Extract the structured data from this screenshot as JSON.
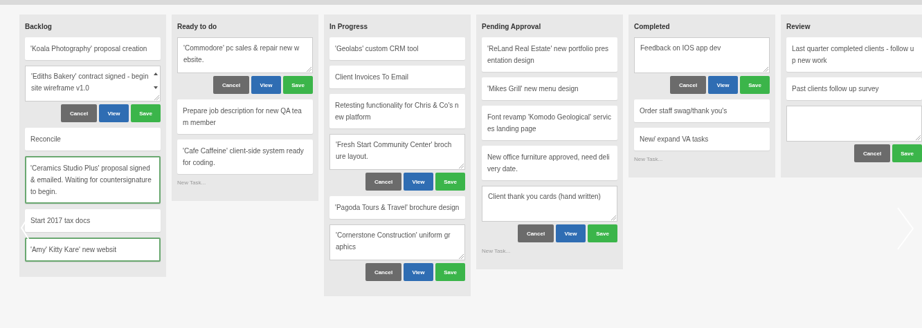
{
  "columns": [
    {
      "title": "Backlog",
      "cards": [
        {
          "kind": "card",
          "text": "'Koala Photography' proposal creation"
        },
        {
          "kind": "editing",
          "text": "'Ediths Bakery' contract signed - begin site wireframe v1.0",
          "scrollable": true,
          "buttons": [
            {
              "kind": "cancel",
              "label": "Cancel"
            },
            {
              "kind": "view",
              "label": "View"
            },
            {
              "kind": "save",
              "label": "Save"
            }
          ]
        },
        {
          "kind": "card",
          "text": "Reconcile"
        },
        {
          "kind": "highlighted",
          "text": "'Ceramics Studio Plus' proposal signed & emailed. Waiting for countersignature to begin."
        },
        {
          "kind": "card",
          "text": "Start 2017 tax docs"
        },
        {
          "kind": "highlighted",
          "text": "'Amy' Kitty Kare' new websit"
        }
      ]
    },
    {
      "title": "Ready to do",
      "cards": [
        {
          "kind": "editing",
          "text": "'Commodore' pc sales & repair new website.",
          "buttons": [
            {
              "kind": "cancel",
              "label": "Cancel"
            },
            {
              "kind": "view",
              "label": "View"
            },
            {
              "kind": "save",
              "label": "Save"
            }
          ]
        },
        {
          "kind": "card",
          "text": "Prepare job description for new QA team member"
        },
        {
          "kind": "card",
          "text": "'Cafe Caffeine' client-side system ready for coding."
        }
      ],
      "new_task_placeholder": "New Task..."
    },
    {
      "title": "In Progress",
      "cards": [
        {
          "kind": "card",
          "text": "'Geolabs' custom CRM tool"
        },
        {
          "kind": "card",
          "text": "Client Invoices To Email"
        },
        {
          "kind": "card",
          "text": "Retesting functionality for Chris & Co's new platform"
        },
        {
          "kind": "editing",
          "text": "'Fresh Start Community Center' brochure layout.",
          "buttons": [
            {
              "kind": "cancel",
              "label": "Cancel"
            },
            {
              "kind": "view",
              "label": "View"
            },
            {
              "kind": "save",
              "label": "Save"
            }
          ]
        },
        {
          "kind": "card",
          "text": "'Pagoda Tours & Travel' brochure design"
        },
        {
          "kind": "editing",
          "text": "'Cornerstone Construction' uniform graphics",
          "buttons": [
            {
              "kind": "cancel",
              "label": "Cancel"
            },
            {
              "kind": "view",
              "label": "View"
            },
            {
              "kind": "save",
              "label": "Save"
            }
          ]
        }
      ]
    },
    {
      "title": "Pending Approval",
      "cards": [
        {
          "kind": "card",
          "text": "'ReLand Real Estate' new portfolio presentation design"
        },
        {
          "kind": "card",
          "text": "'Mikes Grill' new menu design"
        },
        {
          "kind": "card",
          "text": "Font revamp 'Komodo Geological' services landing page"
        },
        {
          "kind": "card",
          "text": "New office furniture approved, need delivery date."
        },
        {
          "kind": "editing",
          "text": "Client thank you cards (hand written)",
          "buttons": [
            {
              "kind": "cancel",
              "label": "Cancel"
            },
            {
              "kind": "view",
              "label": "View"
            },
            {
              "kind": "save",
              "label": "Save"
            }
          ]
        }
      ],
      "new_task_placeholder": "New Task..."
    },
    {
      "title": "Completed",
      "cards": [
        {
          "kind": "editing",
          "text": "Feedback on IOS app dev",
          "buttons": [
            {
              "kind": "cancel",
              "label": "Cancel"
            },
            {
              "kind": "view",
              "label": "View"
            },
            {
              "kind": "save",
              "label": "Save"
            }
          ]
        },
        {
          "kind": "card",
          "text": "Order staff swag/thank you's"
        },
        {
          "kind": "card",
          "text": "New/ expand VA tasks"
        }
      ],
      "new_task_placeholder": "New Task..."
    },
    {
      "title": "Review",
      "cards": [
        {
          "kind": "card",
          "text": "Last quarter completed clients - follow up new work"
        },
        {
          "kind": "card",
          "text": "Past clients follow up survey"
        },
        {
          "kind": "editing",
          "buttons": [
            {
              "kind": "cancel",
              "label": "Cancel"
            },
            {
              "kind": "save",
              "label": "Save"
            }
          ]
        }
      ]
    }
  ]
}
